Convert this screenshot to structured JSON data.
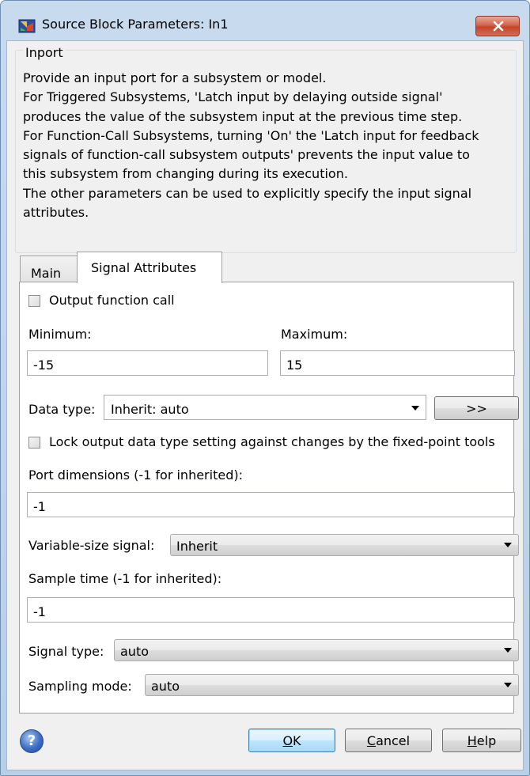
{
  "window": {
    "title": "Source Block Parameters: In1"
  },
  "group": {
    "legend": "Inport",
    "description_lines": [
      "Provide an input port for a subsystem or model.",
      "For Triggered Subsystems, 'Latch input by delaying outside signal'",
      "produces the value of the subsystem input at the previous time step.",
      "For Function-Call Subsystems, turning 'On' the 'Latch input for feedback",
      "signals of function-call subsystem outputs' prevents the input value to",
      "this subsystem from changing during its execution.",
      "The other parameters can be used to explicitly specify the input signal",
      "attributes."
    ]
  },
  "tabs": [
    {
      "label": "Main",
      "active": false
    },
    {
      "label": "Signal Attributes",
      "active": true
    }
  ],
  "form": {
    "output_function_call": {
      "label": "Output function call",
      "checked": false
    },
    "minimum": {
      "label": "Minimum:",
      "value": "-15"
    },
    "maximum": {
      "label": "Maximum:",
      "value": "15"
    },
    "data_type": {
      "label": "Data type:",
      "value": "Inherit: auto",
      "assistant_button": ">>"
    },
    "lock_output": {
      "label": "Lock output data type setting against changes by the fixed-point tools",
      "checked": false
    },
    "port_dimensions": {
      "label": "Port dimensions (-1 for inherited):",
      "value": "-1"
    },
    "variable_size": {
      "label": "Variable-size signal:",
      "value": "Inherit"
    },
    "sample_time": {
      "label": "Sample time (-1 for inherited):",
      "value": "-1"
    },
    "signal_type": {
      "label": "Signal type:",
      "value": "auto"
    },
    "sampling_mode": {
      "label": "Sampling mode:",
      "value": "auto"
    }
  },
  "buttons": {
    "ok": {
      "prefix": "",
      "mnemonic": "O",
      "rest": "K"
    },
    "cancel": {
      "prefix": "",
      "mnemonic": "C",
      "rest": "ancel"
    },
    "help": {
      "prefix": "",
      "mnemonic": "H",
      "rest": "elp"
    }
  },
  "icons": {
    "app": "simulink-block-icon",
    "close": "close-icon",
    "help": "help-icon",
    "dropdown": "chevron-down-icon"
  },
  "colors": {
    "title_bar": "#c8daee",
    "close_button": "#c4442a",
    "dialog_background": "#f0f0f0",
    "ok_button_accent": "#3c7fb1"
  }
}
